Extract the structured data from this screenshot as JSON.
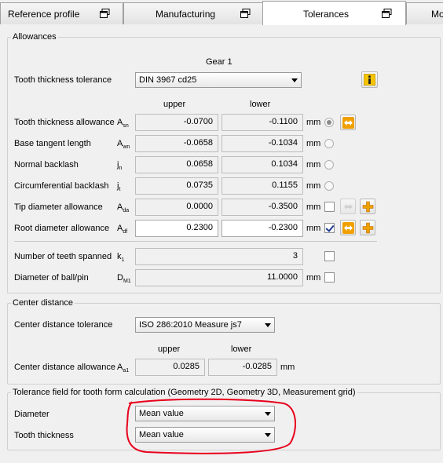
{
  "tabs": [
    {
      "label": "Reference profile"
    },
    {
      "label": "Manufacturing"
    },
    {
      "label": "Tolerances"
    },
    {
      "label": "Mo"
    }
  ],
  "allowances": {
    "legend": "Allowances",
    "gear_header": "Gear 1",
    "tooth_tol_label": "Tooth thickness tolerance",
    "tooth_tol_value": "DIN 3967 cd25",
    "col_upper": "upper",
    "col_lower": "lower",
    "rows": [
      {
        "label": "Tooth thickness allowance",
        "symbol": "A",
        "sub": "sn",
        "upper": "-0.0700",
        "lower": "-0.1100",
        "unit": "mm"
      },
      {
        "label": "Base tangent length",
        "symbol": "A",
        "sub": "wn",
        "upper": "-0.0658",
        "lower": "-0.1034",
        "unit": "mm"
      },
      {
        "label": "Normal backlash",
        "symbol": "j",
        "sub": "n",
        "upper": "0.0658",
        "lower": "0.1034",
        "unit": "mm"
      },
      {
        "label": "Circumferential backlash",
        "symbol": "j",
        "sub": "t",
        "upper": "0.0735",
        "lower": "0.1155",
        "unit": "mm"
      },
      {
        "label": "Tip diameter allowance",
        "symbol": "A",
        "sub": "da",
        "upper": "0.0000",
        "lower": "-0.3500",
        "unit": "mm"
      },
      {
        "label": "Root diameter allowance",
        "symbol": "A",
        "sub": "df",
        "upper": "0.2300",
        "lower": "-0.2300",
        "unit": "mm"
      }
    ],
    "teeth_spanned": {
      "label": "Number of teeth spanned",
      "symbol": "k",
      "sub": "1",
      "value": "3"
    },
    "ball_pin": {
      "label": "Diameter of ball/pin",
      "symbol": "D",
      "sub": "M1",
      "value": "11.0000",
      "unit": "mm"
    }
  },
  "center_distance": {
    "legend": "Center distance",
    "tol_label": "Center distance tolerance",
    "tol_value": "ISO 286:2010 Measure js7",
    "col_upper": "upper",
    "col_lower": "lower",
    "allow_label": "Center distance allowance",
    "symbol": "A",
    "sub": "a1",
    "upper": "0.0285",
    "lower": "-0.0285",
    "unit": "mm"
  },
  "tolerance_field": {
    "legend": "Tolerance field for tooth form calculation (Geometry 2D, Geometry 3D, Measurement grid)",
    "diameter_label": "Diameter",
    "diameter_value": "Mean value",
    "thickness_label": "Tooth thickness",
    "thickness_value": "Mean value"
  },
  "colors": {
    "annotation": "#e8001c",
    "accent_orange": "#f0a000",
    "info_yellow": "#f4c400"
  }
}
